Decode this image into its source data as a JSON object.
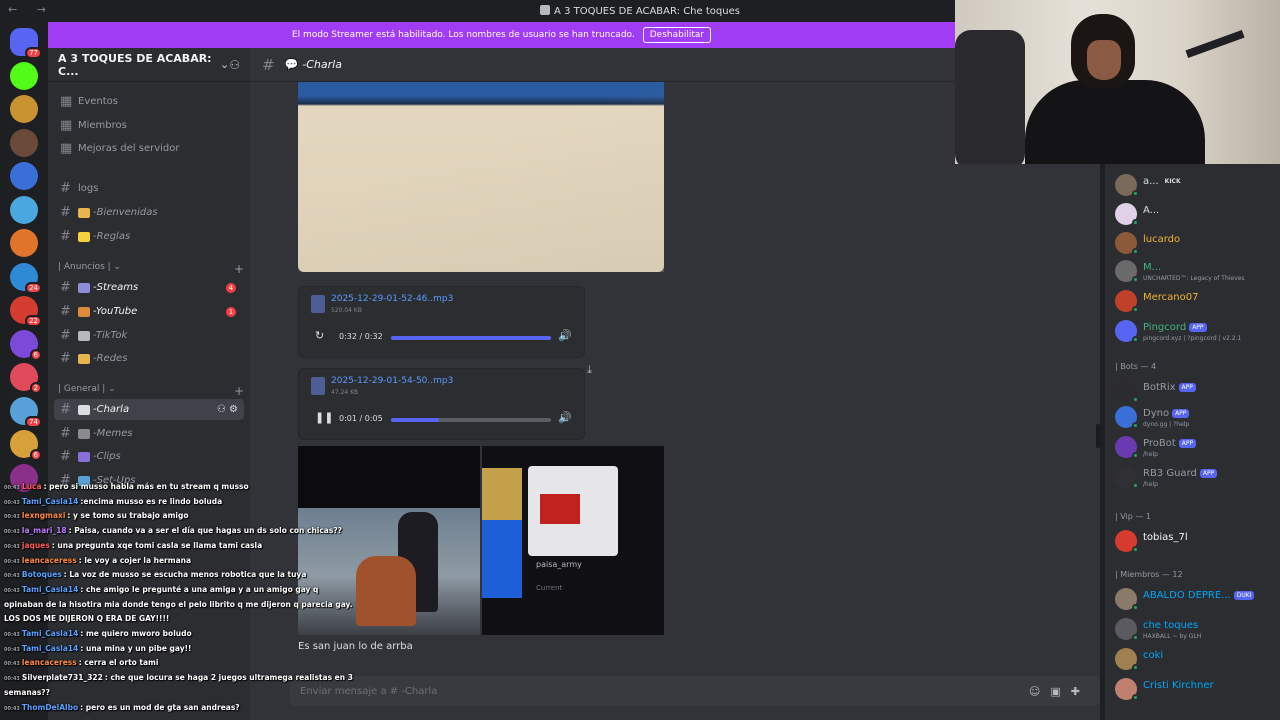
{
  "window": {
    "title": "A 3 TOQUES DE ACABAR: Che toques",
    "nav": "← →"
  },
  "banner": {
    "text": "El modo Streamer está habilitado. Los nombres de usuario se han truncado.",
    "button": "Deshabilitar"
  },
  "rail": {
    "servers": [
      {
        "color": "#5865f2",
        "badge": "77"
      },
      {
        "color": "#53fc18",
        "badge": ""
      },
      {
        "color": "#c9932f",
        "badge": ""
      },
      {
        "color": "#6b4a3a",
        "badge": ""
      },
      {
        "color": "#3a6fd8",
        "badge": ""
      },
      {
        "color": "#4aa7e0",
        "badge": ""
      },
      {
        "color": "#e0742a",
        "badge": ""
      },
      {
        "color": "#2f8ad6",
        "badge": "24"
      },
      {
        "color": "#d63b2f",
        "badge": "22"
      },
      {
        "color": "#7b4ad8",
        "badge": "6"
      },
      {
        "color": "#e04a5a",
        "badge": "2"
      },
      {
        "color": "#5aa0d8",
        "badge": "74"
      },
      {
        "color": "#d8a03b",
        "badge": "6"
      },
      {
        "color": "#8a2f8a",
        "badge": ""
      }
    ]
  },
  "sidebar": {
    "guild_name": "A 3 TOQUES DE ACABAR: C...",
    "top_items": [
      "Eventos",
      "Miembros",
      "Mejoras del servidor"
    ],
    "channels_a": [
      {
        "label": "logs",
        "emoji": "",
        "italic": false
      },
      {
        "label": "-Bienvenidas",
        "emoji": "#e9b44c",
        "italic": true
      },
      {
        "label": "-Reglas",
        "emoji": "#f5d142",
        "italic": true
      }
    ],
    "cat_anuncios": "| Anuncios |",
    "channels_b": [
      {
        "label": "-Streams",
        "emoji": "#8b8fd9",
        "badge": "4"
      },
      {
        "label": "-YouTube",
        "emoji": "#e08a3c",
        "badge": "1"
      },
      {
        "label": "-TikTok",
        "emoji": "#b5bac1",
        "badge": ""
      },
      {
        "label": "-Redes",
        "emoji": "#e9b44c",
        "badge": ""
      }
    ],
    "cat_general": "| General |",
    "channels_c": [
      {
        "label": "-Charla",
        "emoji": "#dbdee1",
        "active": true
      },
      {
        "label": "-Memes",
        "emoji": "#8a8a90",
        "active": false
      },
      {
        "label": "-Clips",
        "emoji": "#8b6fd9",
        "active": false
      },
      {
        "label": "-Set-Ups",
        "emoji": "#5aa0d8",
        "active": false
      }
    ]
  },
  "chat_header": {
    "channel": "-Charla"
  },
  "messages": {
    "audio": [
      {
        "name": "2025-12-29-01-52-46..mp3",
        "size": "520.04 KB",
        "time": "0:32 / 0:32",
        "progress": 1.0
      },
      {
        "name": "2025-12-29-01-54-50..mp3",
        "size": "47.24 KB",
        "time": "0:01 / 0:05",
        "progress": 0.3
      }
    ],
    "gallery_name": "paisa_army",
    "gallery_status": "Current",
    "text": "Es san juan lo de arrba"
  },
  "composer": {
    "placeholder": "Enviar mensaje a # -Charla"
  },
  "members": {
    "list": [
      {
        "name": "a...",
        "color": "#dbdee1",
        "tag": "KICK",
        "sub": "",
        "av": "#7a6a5a"
      },
      {
        "name": "A...",
        "color": "#dbdee1",
        "tag": "",
        "sub": "",
        "av": "#e0d0e8"
      },
      {
        "name": "lucardo",
        "color": "#f0b232",
        "tag": "",
        "sub": "",
        "av": "#8a5a3a"
      },
      {
        "name": "M...",
        "color": "#43b581",
        "tag": "",
        "sub": "UNCHARTED™: Legacy of Thieves",
        "av": "#6a6a6a"
      },
      {
        "name": "Mercano07",
        "color": "#f0b232",
        "tag": "",
        "sub": "",
        "av": "#c0402a"
      },
      {
        "name": "Pingcord",
        "color": "#43b581",
        "tag": "APP",
        "sub": "pingcord.xyz | ?pingcord | v2.2.1",
        "av": "#5865f2"
      }
    ],
    "bots_label": "| Bots — 4",
    "bots": [
      {
        "name": "BotRix",
        "color": "#949ba4",
        "tag": "APP",
        "sub": "",
        "av": "#2b2b30"
      },
      {
        "name": "Dyno",
        "color": "#949ba4",
        "tag": "APP",
        "sub": "dyno.gg | ?help",
        "av": "#3a6fd8"
      },
      {
        "name": "ProBot",
        "color": "#949ba4",
        "tag": "APP",
        "sub": "/help",
        "av": "#6a3ab0"
      },
      {
        "name": "RB3 Guard",
        "color": "#949ba4",
        "tag": "APP",
        "sub": "/help",
        "av": "#2f2f34"
      }
    ],
    "vip_label": "| Vip — 1",
    "vip": [
      {
        "name": "tobias_7l",
        "color": "#f2f3f5",
        "tag": "",
        "sub": "",
        "av": "#d63b2f"
      }
    ],
    "miembros_label": "| Miembros — 12",
    "miembros": [
      {
        "name": "ABALDO DEPRE...",
        "color": "#00a8fc",
        "tag": "DUKI",
        "sub": "",
        "av": "#8a7a6a"
      },
      {
        "name": "che toques",
        "color": "#00a8fc",
        "tag": "",
        "sub": "HAXBALL ~ by GLH",
        "av": "#5a5a60"
      },
      {
        "name": "coki",
        "color": "#00a8fc",
        "tag": "",
        "sub": "",
        "av": "#a08050"
      },
      {
        "name": "Cristi Kirchner",
        "color": "#00a8fc",
        "tag": "",
        "sub": "",
        "av": "#c08070"
      }
    ]
  },
  "stream_chat": [
    {
      "user": "Luca",
      "color": "#ff5a5a",
      "msg": ": pero si musso habla más en tu stream q musso"
    },
    {
      "user": "Tami_Casla14",
      "color": "#5aa0ff",
      "msg": ":encima musso es re lindo boluda"
    },
    {
      "user": "lexngmaxi",
      "color": "#ff8a3c",
      "msg": ": y se tomo su trabajo amigo"
    },
    {
      "user": "la_mari_18",
      "color": "#c07aff",
      "msg": ": Paisa, cuando va a ser el día que hagas un ds solo con chicas??"
    },
    {
      "user": "jaques",
      "color": "#ff5a5a",
      "msg": ": una pregunta xqe tomi casla se llama tami casla"
    },
    {
      "user": "leancaceress",
      "color": "#ff8a3c",
      "msg": ": le voy a cojer la hermana"
    },
    {
      "user": "Botoques",
      "color": "#5aa0ff",
      "msg": ": La voz de musso se escucha menos robotica que la tuya"
    },
    {
      "user": "Tami_Casla14",
      "color": "#5aa0ff",
      "msg": ": che amigo le pregunté a una amiga y a un amigo gay q"
    },
    {
      "user": "",
      "color": "#ffffff",
      "msg": "opinaban de la hisotira mia donde tengo el pelo librito q me dijeron q parecia gay."
    },
    {
      "user": "",
      "color": "#ffffff",
      "msg": "LOS DOS ME DIJERON Q ERA DE GAY!!!!"
    },
    {
      "user": "Tami_Casla14",
      "color": "#5aa0ff",
      "msg": ": me quiero mworo boludo"
    },
    {
      "user": "Tami_Casla14",
      "color": "#5aa0ff",
      "msg": ": una mina y un pibe gay!!"
    },
    {
      "user": "leancaceress",
      "color": "#ff8a3c",
      "msg": ": cerra el orto tami"
    },
    {
      "user": "Silverplate731_322",
      "color": "#ffffff",
      "msg": ": che que locura se haga 2 juegos ultramega realistas en 3"
    },
    {
      "user": "",
      "color": "#ffffff",
      "msg": "semanas??"
    },
    {
      "user": "ThomDelAlbo",
      "color": "#5aa0ff",
      "msg": ": pero es un mod de gta san andreas?"
    }
  ]
}
